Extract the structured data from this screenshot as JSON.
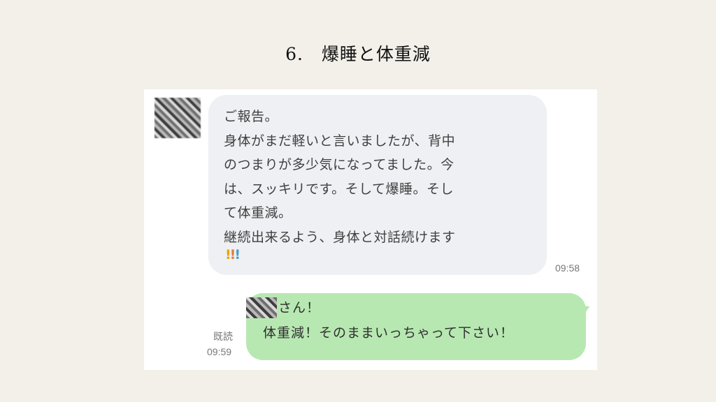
{
  "slide": {
    "title": "6.　爆睡と体重減"
  },
  "chat": {
    "incoming": {
      "text": "ご報告。\n身体がまだ軽いと言いましたが、背中\nのつまりが多少気になってました。今\nは、スッキリです。そして爆睡。そし\nて体重減。\n継続出来るよう、身体と対話続けます",
      "emoji": [
        "!",
        "!",
        "!"
      ],
      "time": "09:58"
    },
    "outgoing": {
      "line1": "さん！",
      "line2": "体重減！そのままいっちゃって下さい！",
      "read_label": "既読",
      "time": "09:59"
    }
  }
}
